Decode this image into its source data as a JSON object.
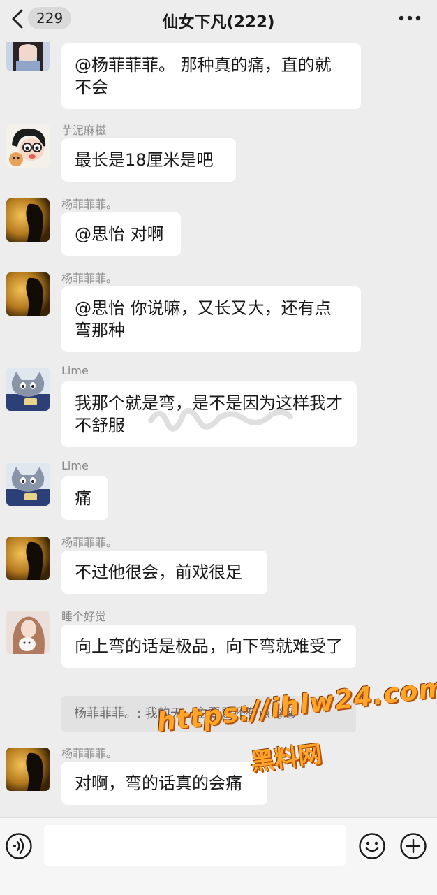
{
  "header": {
    "unread_count": "229",
    "title": "仙女下凡(222)"
  },
  "messages": [
    {
      "sender": "",
      "text": "@杨菲菲菲。 那种真的痛，直的就不会",
      "avatar": "woman-portrait-avatar"
    },
    {
      "sender": "芋泥麻糍",
      "text": "最长是18厘米是吧",
      "avatar": "cartoon-girl-avatar"
    },
    {
      "sender": "杨菲菲菲。",
      "text": "@思怡 对啊",
      "avatar": "golden-silhouette-avatar"
    },
    {
      "sender": "杨菲菲菲。",
      "text": "@思怡 你说嘛，又长又大，还有点弯那种",
      "avatar": "golden-silhouette-avatar"
    },
    {
      "sender": "Lime",
      "text": "我那个就是弯，是不是因为这样我才不舒服",
      "avatar": "cartoon-cat-avatar"
    },
    {
      "sender": "Lime",
      "text": "痛",
      "avatar": "cartoon-cat-avatar"
    },
    {
      "sender": "杨菲菲菲。",
      "text": "不过他很会，前戏很足",
      "avatar": "golden-silhouette-avatar"
    },
    {
      "sender": "睡个好觉",
      "text": "向上弯的话是极品，向下弯就难受了",
      "avatar": "girl-with-cat-avatar"
    },
    {
      "sender": "杨菲菲菲。",
      "text": "对啊，弯的话真的会痛",
      "avatar": "golden-silhouette-avatar"
    }
  ],
  "quote": {
    "text": "杨菲菲菲。: 我的天，主要是还有点弯😭"
  },
  "watermark": {
    "line1": "https://ihlw24.com",
    "line2": "黑料网"
  },
  "input_bar": {
    "placeholder": ""
  },
  "colors": {
    "background": "#ededed",
    "bubble": "#ffffff",
    "watermark": "#ffa52a"
  }
}
